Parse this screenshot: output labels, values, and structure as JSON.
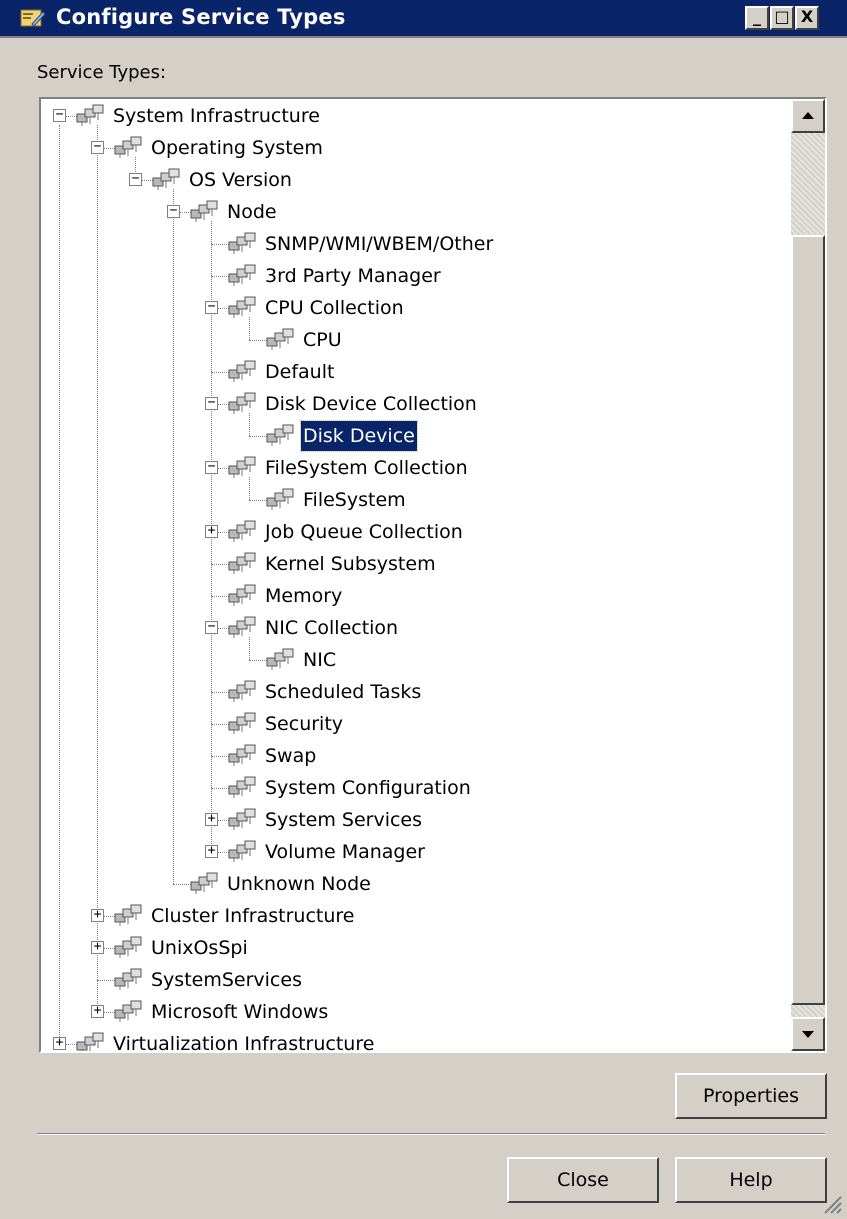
{
  "window": {
    "title": "Configure Service Types",
    "controls": [
      "_",
      "□",
      "X"
    ]
  },
  "tree_label": "Service Types:",
  "tree": {
    "selected": "Disk Device",
    "nodes": [
      {
        "label": "System Infrastructure",
        "depth": 0,
        "expander": "-"
      },
      {
        "label": "Operating System",
        "depth": 1,
        "expander": "-"
      },
      {
        "label": "OS Version",
        "depth": 2,
        "expander": "-"
      },
      {
        "label": "Node",
        "depth": 3,
        "expander": "-"
      },
      {
        "label": "SNMP/WMI/WBEM/Other",
        "depth": 4,
        "expander": ""
      },
      {
        "label": "3rd Party Manager",
        "depth": 4,
        "expander": ""
      },
      {
        "label": "CPU Collection",
        "depth": 4,
        "expander": "-"
      },
      {
        "label": "CPU",
        "depth": 5,
        "expander": ""
      },
      {
        "label": "Default",
        "depth": 4,
        "expander": ""
      },
      {
        "label": "Disk Device Collection",
        "depth": 4,
        "expander": "-"
      },
      {
        "label": "Disk Device",
        "depth": 5,
        "expander": ""
      },
      {
        "label": "FileSystem Collection",
        "depth": 4,
        "expander": "-"
      },
      {
        "label": "FileSystem",
        "depth": 5,
        "expander": ""
      },
      {
        "label": "Job Queue Collection",
        "depth": 4,
        "expander": "+"
      },
      {
        "label": "Kernel Subsystem",
        "depth": 4,
        "expander": ""
      },
      {
        "label": "Memory",
        "depth": 4,
        "expander": ""
      },
      {
        "label": "NIC Collection",
        "depth": 4,
        "expander": "-"
      },
      {
        "label": "NIC",
        "depth": 5,
        "expander": ""
      },
      {
        "label": "Scheduled Tasks",
        "depth": 4,
        "expander": ""
      },
      {
        "label": "Security",
        "depth": 4,
        "expander": ""
      },
      {
        "label": "Swap",
        "depth": 4,
        "expander": ""
      },
      {
        "label": "System Configuration",
        "depth": 4,
        "expander": ""
      },
      {
        "label": "System Services",
        "depth": 4,
        "expander": "+"
      },
      {
        "label": "Volume Manager",
        "depth": 4,
        "expander": "+"
      },
      {
        "label": "Unknown Node",
        "depth": 3,
        "expander": ""
      },
      {
        "label": "Cluster Infrastructure",
        "depth": 1,
        "expander": "+"
      },
      {
        "label": "UnixOsSpi",
        "depth": 1,
        "expander": "+"
      },
      {
        "label": "SystemServices",
        "depth": 1,
        "expander": ""
      },
      {
        "label": "Microsoft Windows",
        "depth": 1,
        "expander": "+"
      },
      {
        "label": "Virtualization Infrastructure",
        "depth": 0,
        "expander": "+"
      }
    ]
  },
  "buttons": {
    "properties": "Properties",
    "close": "Close",
    "help": "Help"
  },
  "colors": {
    "titlebar": "#0a246a",
    "selection": "#0a246a",
    "dialog": "#d4d0c8"
  },
  "icons": {
    "window": "service-config-icon",
    "node": "service-type-icon"
  }
}
